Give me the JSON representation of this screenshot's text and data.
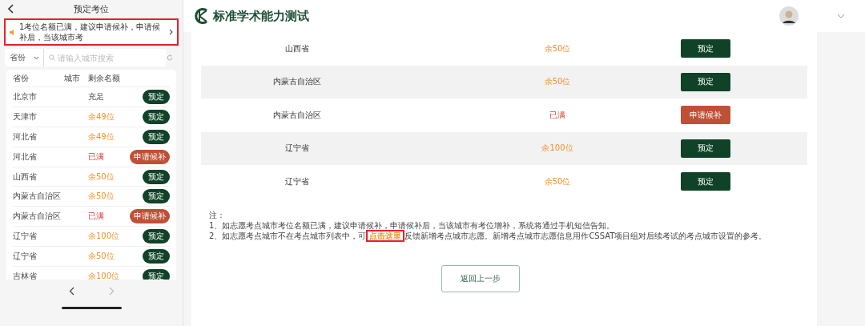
{
  "mobile": {
    "title": "预定考位",
    "notice": "1考位名额已满，建议申请候补，申请候补后，当该城市考",
    "filter": {
      "province": "省份",
      "placeholder": "请输入城市搜索"
    },
    "columns": [
      "省份",
      "城市",
      "剩余名额"
    ],
    "rows": [
      {
        "province": "北京市",
        "remaining": "充足",
        "kind": "plenty",
        "action": "预定"
      },
      {
        "province": "天津市",
        "remaining": "余49位",
        "kind": "available",
        "action": "预定"
      },
      {
        "province": "河北省",
        "remaining": "余49位",
        "kind": "available",
        "action": "预定"
      },
      {
        "province": "河北省",
        "remaining": "已满",
        "kind": "full",
        "action": "申请候补"
      },
      {
        "province": "山西省",
        "remaining": "余50位",
        "kind": "available",
        "action": "预定"
      },
      {
        "province": "内蒙古自治区",
        "remaining": "余50位",
        "kind": "available",
        "action": "预定"
      },
      {
        "province": "内蒙古自治区",
        "remaining": "已满",
        "kind": "full",
        "action": "申请候补"
      },
      {
        "province": "辽宁省",
        "remaining": "余100位",
        "kind": "available",
        "action": "预定"
      },
      {
        "province": "辽宁省",
        "remaining": "余50位",
        "kind": "available",
        "action": "预定"
      },
      {
        "province": "吉林省",
        "remaining": "余100位",
        "kind": "available",
        "action": "预定"
      }
    ],
    "highlighted_notice": true
  },
  "header": {
    "logo": "标准学术能力测试"
  },
  "table": {
    "rows": [
      {
        "province": "山西省",
        "remaining": "余50位",
        "kind": "available",
        "action": "预定"
      },
      {
        "province": "内蒙古自治区",
        "remaining": "余50位",
        "kind": "available",
        "action": "预定"
      },
      {
        "province": "内蒙古自治区",
        "remaining": "已满",
        "kind": "full",
        "action": "申请候补"
      },
      {
        "province": "辽宁省",
        "remaining": "余100位",
        "kind": "available",
        "action": "预定"
      },
      {
        "province": "辽宁省",
        "remaining": "余50位",
        "kind": "available",
        "action": "预定"
      }
    ]
  },
  "notes": {
    "heading": "注：",
    "line1": "1、如志愿考点城市考位名额已满，建议申请候补，申请候补后，当该城市有考位增补，系统将通过手机短信告知。",
    "line2_before": "2、如志愿考点城市不在考点城市列表中，可",
    "link": "点击这里",
    "link_highlighted": true,
    "line2_after": "反馈新增考点城市志愿。新增考点城市志愿信息用作CSSAT项目组对后续考试的考点城市设置的参考。"
  },
  "back_button": "返回上一步"
}
